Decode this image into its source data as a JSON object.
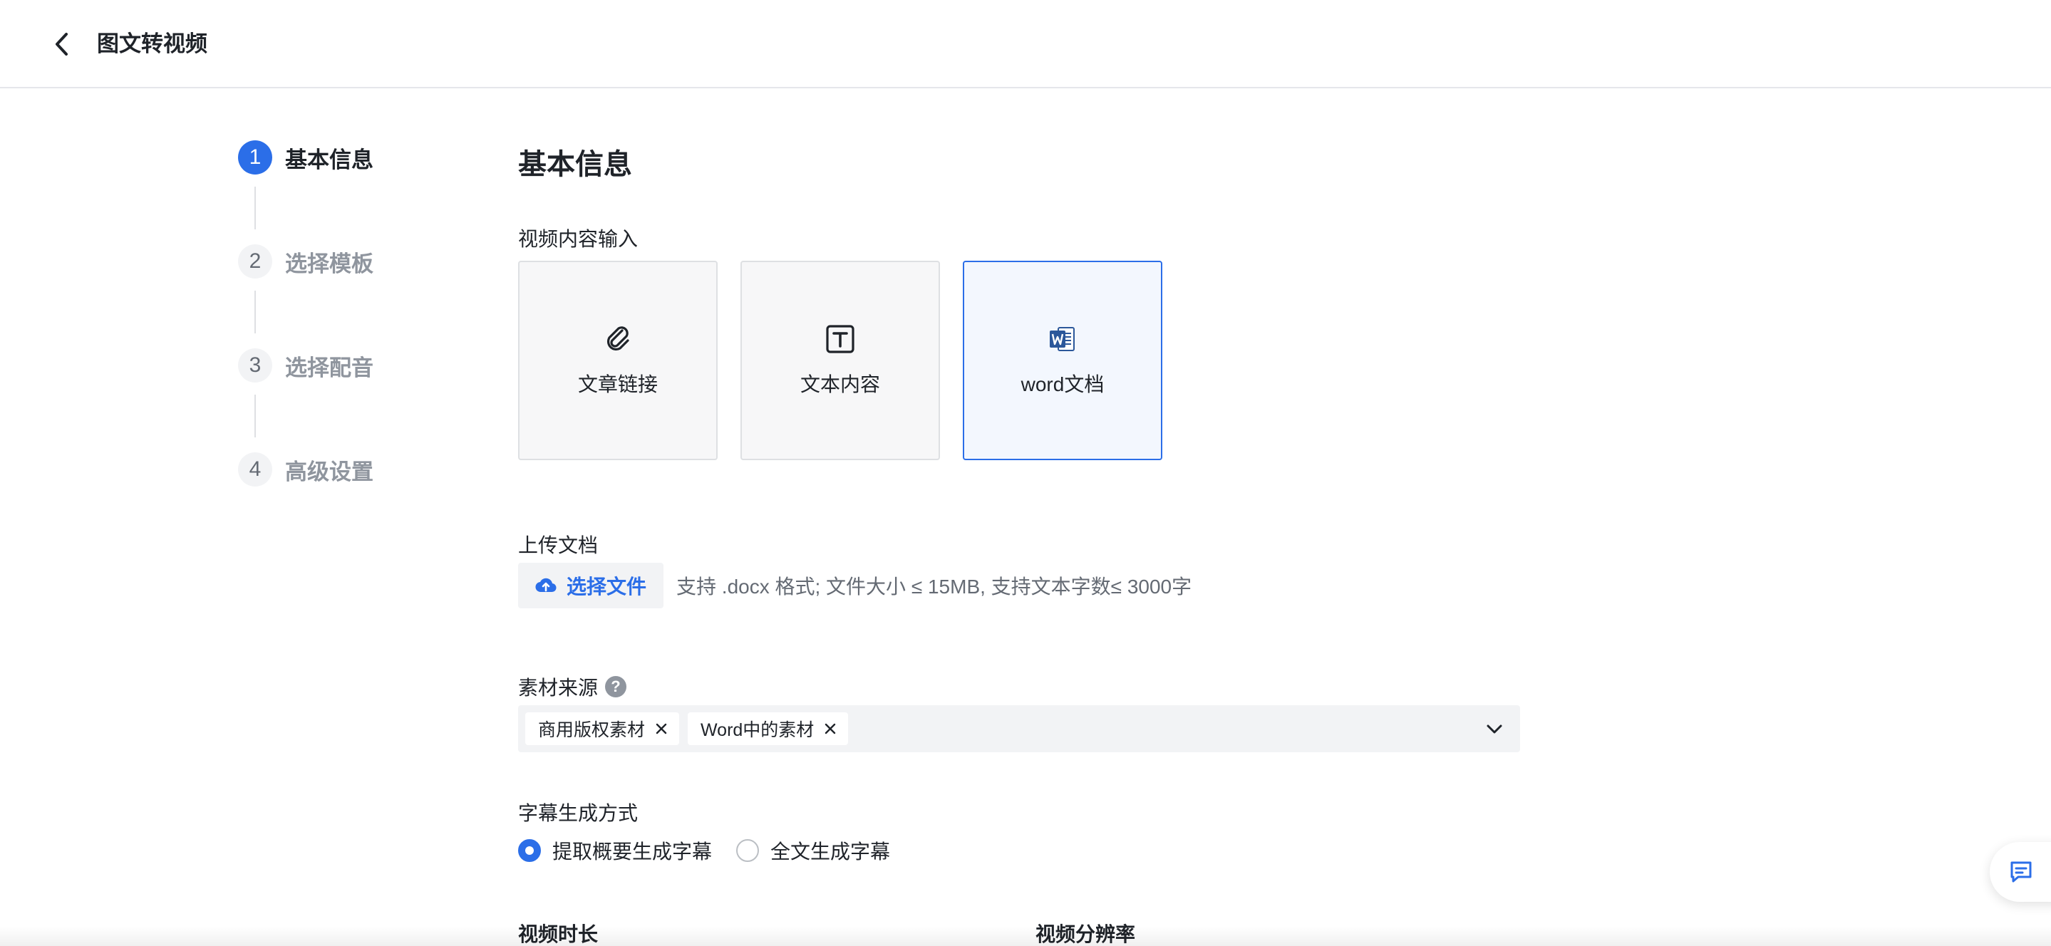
{
  "header": {
    "title": "图文转视频"
  },
  "steps": [
    {
      "num": "1",
      "label": "基本信息",
      "active": true
    },
    {
      "num": "2",
      "label": "选择模板",
      "active": false
    },
    {
      "num": "3",
      "label": "选择配音",
      "active": false
    },
    {
      "num": "4",
      "label": "高级设置",
      "active": false
    }
  ],
  "main": {
    "section_title": "基本信息",
    "content_input": {
      "label": "视频内容输入",
      "options": [
        {
          "label": "文章链接",
          "icon": "paperclip-icon"
        },
        {
          "label": "文本内容",
          "icon": "text-box-icon"
        },
        {
          "label": "word文档",
          "icon": "word-doc-icon",
          "selected": true
        }
      ]
    },
    "upload": {
      "label": "上传文档",
      "button_label": "选择文件",
      "hint": "支持 .docx 格式; 文件大小 ≤ 15MB, 支持文本字数≤ 3000字"
    },
    "material_source": {
      "label": "素材来源",
      "tags": [
        "商用版权素材",
        "Word中的素材"
      ]
    },
    "subtitle_mode": {
      "label": "字幕生成方式",
      "options": [
        {
          "label": "提取概要生成字幕",
          "checked": true
        },
        {
          "label": "全文生成字幕",
          "checked": false
        }
      ]
    },
    "video_duration_label": "视频时长",
    "video_resolution_label": "视频分辨率"
  },
  "colors": {
    "accent": "#2b6ee8",
    "word_blue": "#2b579a"
  }
}
